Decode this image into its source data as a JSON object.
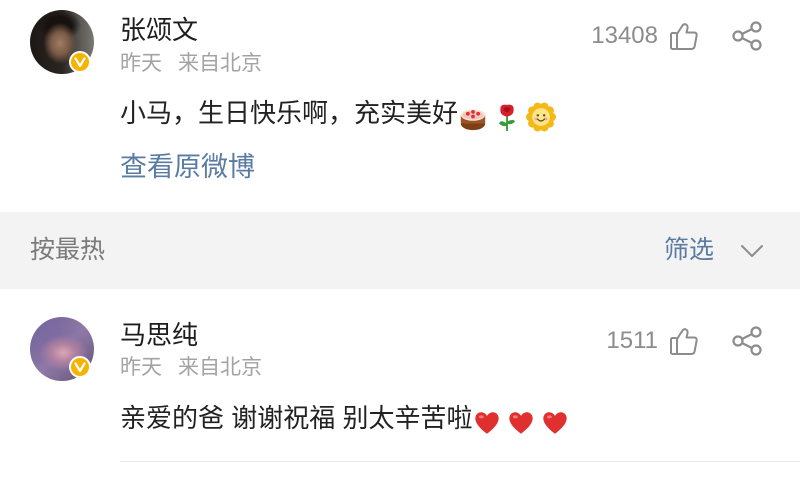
{
  "colors": {
    "link": "#5b7ba3",
    "sort_bar_background": "#f3f3f3",
    "meta_text": "#a3a3a3",
    "body_text": "#222222",
    "icon": "#8c8c8c",
    "verified_badge": "#f6b400"
  },
  "icons": {
    "verified": "verified-badge-icon",
    "like": "thumbs-up-icon",
    "share": "share-icon",
    "filter": "chevron-down-icon"
  },
  "post": {
    "author": "张颂文",
    "time": "昨天",
    "source": "来自北京",
    "likes": "13408",
    "text": "小马，生日快乐啊，充实美好",
    "emojis": [
      "cake-emoji",
      "rose-emoji",
      "sun-face-emoji"
    ],
    "view_original_label": "查看原微博"
  },
  "sort_bar": {
    "sort_label": "按最热",
    "filter_label": "筛选"
  },
  "comments": [
    {
      "author": "马思纯",
      "time": "昨天",
      "source": "来自北京",
      "likes": "1511",
      "text": "亲爱的爸 谢谢祝福 别太辛苦啦",
      "emojis": [
        "red-heart-emoji",
        "red-heart-emoji",
        "red-heart-emoji"
      ]
    }
  ]
}
